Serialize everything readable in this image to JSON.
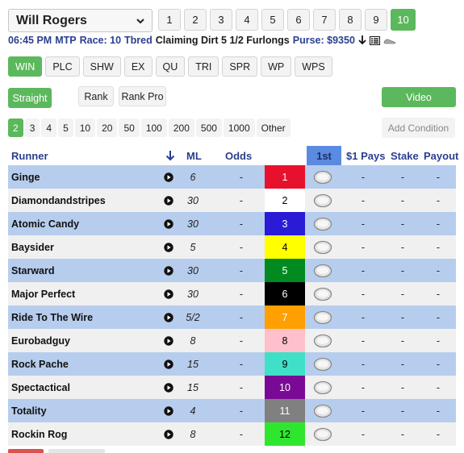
{
  "track": {
    "name": "Will Rogers",
    "icon": "chevron-down-icon"
  },
  "races": [
    "1",
    "2",
    "3",
    "4",
    "5",
    "6",
    "7",
    "8",
    "9",
    "10"
  ],
  "active_race": "10",
  "race_info": {
    "time": "06:45 PM",
    "mtp": "MTP",
    "race_label": "Race: 10",
    "breed": "Tbred",
    "description": "Claiming Dirt 5 1/2 Furlongs",
    "purse": "Purse: $9350"
  },
  "bet_types": [
    "WIN",
    "PLC",
    "SHW",
    "EX",
    "QU",
    "TRI",
    "SPR",
    "WP",
    "WPS"
  ],
  "active_bet": "WIN",
  "mode": {
    "straight": "Straight",
    "rank": "Rank",
    "rank_pro": "Rank Pro",
    "video": "Video"
  },
  "counts": [
    "2",
    "3",
    "4",
    "5",
    "10",
    "20",
    "50",
    "100",
    "200",
    "500",
    "1000",
    "Other"
  ],
  "active_count": "2",
  "add_condition": "Add Condition",
  "headers": {
    "runner": "Runner",
    "ml": "ML",
    "odds": "Odds",
    "first": "1st",
    "pays": "$1 Pays",
    "stake": "Stake",
    "payout": "Payout"
  },
  "runners": [
    {
      "name": "Ginge",
      "ml": "6",
      "odds": "-",
      "pp": "1",
      "pays": "-",
      "stake": "-",
      "payout": "-"
    },
    {
      "name": "Diamondandstripes",
      "ml": "30",
      "odds": "-",
      "pp": "2",
      "pays": "-",
      "stake": "-",
      "payout": "-"
    },
    {
      "name": "Atomic Candy",
      "ml": "30",
      "odds": "-",
      "pp": "3",
      "pays": "-",
      "stake": "-",
      "payout": "-"
    },
    {
      "name": "Baysider",
      "ml": "5",
      "odds": "-",
      "pp": "4",
      "pays": "-",
      "stake": "-",
      "payout": "-"
    },
    {
      "name": "Starward",
      "ml": "30",
      "odds": "-",
      "pp": "5",
      "pays": "-",
      "stake": "-",
      "payout": "-"
    },
    {
      "name": "Major Perfect",
      "ml": "30",
      "odds": "-",
      "pp": "6",
      "pays": "-",
      "stake": "-",
      "payout": "-"
    },
    {
      "name": "Ride To The Wire",
      "ml": "5/2",
      "odds": "-",
      "pp": "7",
      "pays": "-",
      "stake": "-",
      "payout": "-"
    },
    {
      "name": "Eurobadguy",
      "ml": "8",
      "odds": "-",
      "pp": "8",
      "pays": "-",
      "stake": "-",
      "payout": "-"
    },
    {
      "name": "Rock Pache",
      "ml": "15",
      "odds": "-",
      "pp": "9",
      "pays": "-",
      "stake": "-",
      "payout": "-"
    },
    {
      "name": "Spectactical",
      "ml": "15",
      "odds": "-",
      "pp": "10",
      "pays": "-",
      "stake": "-",
      "payout": "-"
    },
    {
      "name": "Totality",
      "ml": "4",
      "odds": "-",
      "pp": "11",
      "pays": "-",
      "stake": "-",
      "payout": "-"
    },
    {
      "name": "Rockin Rog",
      "ml": "8",
      "odds": "-",
      "pp": "12",
      "pays": "-",
      "stake": "-",
      "payout": "-"
    }
  ],
  "saddle_cloths": [
    {
      "bg": "#e8112d",
      "fg": "#ffffff"
    },
    {
      "bg": "#ffffff",
      "fg": "#000000"
    },
    {
      "bg": "#2a1bd6",
      "fg": "#ffffff"
    },
    {
      "bg": "#ffff00",
      "fg": "#000000"
    },
    {
      "bg": "#008a1f",
      "fg": "#ffffff"
    },
    {
      "bg": "#000000",
      "fg": "#ffffff"
    },
    {
      "bg": "#ff9f00",
      "fg": "#ffffff"
    },
    {
      "bg": "#ffc0cb",
      "fg": "#000000"
    },
    {
      "bg": "#40e0c8",
      "fg": "#000000"
    },
    {
      "bg": "#7a0a96",
      "fg": "#ffffff"
    },
    {
      "bg": "#808080",
      "fg": "#ffffff"
    },
    {
      "bg": "#2fe62f",
      "fg": "#000000"
    }
  ],
  "colors": {
    "accent": "#5cb85c",
    "header_blue": "#2a3f8f",
    "first_col": "#5b8be0",
    "row_blue": "#b7cdee",
    "row_grey": "#f0f0f0"
  }
}
